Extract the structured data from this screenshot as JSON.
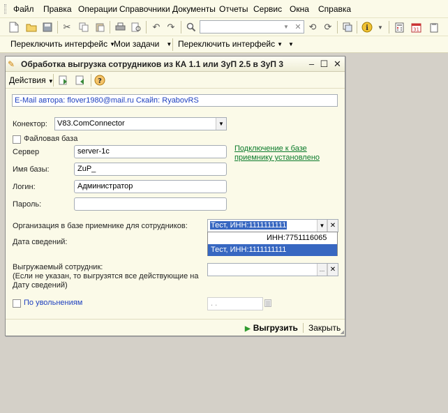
{
  "menu": {
    "items": [
      "Файл",
      "Правка",
      "Операции",
      "Справочники",
      "Документы",
      "Отчеты",
      "Сервис",
      "Окна",
      "Справка"
    ]
  },
  "toolbar": {
    "icons": [
      "new-document-icon",
      "open-folder-icon",
      "save-icon",
      "cut-icon",
      "copy-icon",
      "paste-icon",
      "print-icon",
      "print-preview-icon",
      "undo-icon",
      "redo-icon",
      "search-icon",
      "search-input",
      "search-next-icon",
      "search-prev-icon",
      "windows-icon",
      "info-icon",
      "calculator-icon",
      "calendar-icon",
      "clipboard-icon"
    ],
    "search_value": "",
    "calendar_day": "31"
  },
  "toolbar2": {
    "switch_interface_1": "Переключить интерфейс",
    "my_tasks": "Мои задачи",
    "switch_interface_2": "Переключить интерфейс"
  },
  "dialog": {
    "title": "Обработка  выгрузка сотрудников из КА 1.1 или ЗуП 2.5 в ЗуП 3",
    "actions_label": "Действия",
    "author_info": "E-Mail автора: flover1980@mail.ru    Скайп: RyabovRS",
    "connector_label": "Конектор:",
    "connector_value": "V83.ComConnector",
    "file_base_label": "Файловая база",
    "server_label": "Сервер",
    "server_value": "server-1c",
    "dbname_label": "Имя базы:",
    "dbname_value": "ZuP_",
    "login_label": "Логин:",
    "login_value": "Администратор",
    "password_label": "Пароль:",
    "password_value": "",
    "connection_status": "Подключение к базе приемнику установлено",
    "connection_status_line1": "Подключение к базе",
    "connection_status_line2": "приемнику установлено",
    "org_label": "Организация в базе приемнике для сотрудников:",
    "org_value": "Тест, ИНН:1111111111",
    "date_label": "Дата сведений:",
    "dropdown_options": [
      "ИНН:7751116065",
      "Тест, ИНН:1111111111"
    ],
    "employee_label_line1": "Выгружаемый сотрудник:",
    "employee_label_line2": "(Если не указан, то выгрузятся все действующие на",
    "employee_label_line3": "Дату сведений)",
    "employee_value": "",
    "dismissal_label": "По увольнениям",
    "dismissal_date_value": " .  .",
    "run_button": "Выгрузить",
    "close_button": "Закрыть"
  },
  "colors": {
    "accent_selection": "#3767c1",
    "link_green": "#0a7a2a",
    "email_blue": "#1d3fbf",
    "panel_bg": "#fbfae8"
  }
}
